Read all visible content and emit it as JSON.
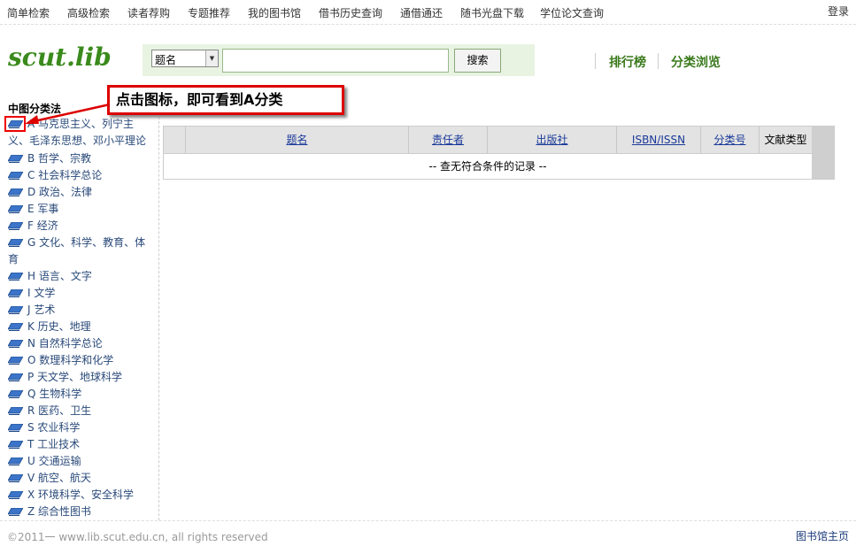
{
  "topnav": {
    "items": [
      "简单检索",
      "高级检索",
      "读者荐购",
      "专题推荐",
      "我的图书馆",
      "借书历史查询",
      "通借通还",
      "随书光盘下载",
      "学位论文查询"
    ],
    "login": "登录"
  },
  "logo": "scut.lib",
  "search": {
    "field_selected": "题名",
    "query": "",
    "button": "搜索"
  },
  "right_links": {
    "ranking": "排行榜",
    "browse": "分类浏览"
  },
  "sidebar": {
    "title": "中图分类法",
    "categories": [
      "A 马克思主义、列宁主义、毛泽东思想、邓小平理论",
      "B 哲学、宗教",
      "C 社会科学总论",
      "D 政治、法律",
      "E 军事",
      "F 经济",
      "G 文化、科学、教育、体育",
      "H 语言、文字",
      "I 文学",
      "J 艺术",
      "K 历史、地理",
      "N 自然科学总论",
      "O 数理科学和化学",
      "P 天文学、地球科学",
      "Q 生物科学",
      "R 医药、卫生",
      "S 农业科学",
      "T 工业技术",
      "U 交通运输",
      "V 航空、航天",
      "X 环境科学、安全科学",
      "Z 综合性图书"
    ]
  },
  "callout": "点击图标，即可看到A分类",
  "table": {
    "headers": [
      "题名",
      "责任者",
      "出版社",
      "ISBN/ISSN",
      "分类号",
      "文献类型"
    ],
    "empty": "-- 查无符合条件的记录 --"
  },
  "footer": {
    "copyright": "©2011一 www.lib.scut.edu.cn, all rights reserved",
    "home": "图书馆主页"
  },
  "colors": {
    "accent_green": "#3a8a1c",
    "link_blue": "#1a3a9a",
    "callout_red": "#dd0000"
  },
  "icons": {
    "category_icon": "book-icon",
    "select_arrow": "chevron-down-icon"
  }
}
